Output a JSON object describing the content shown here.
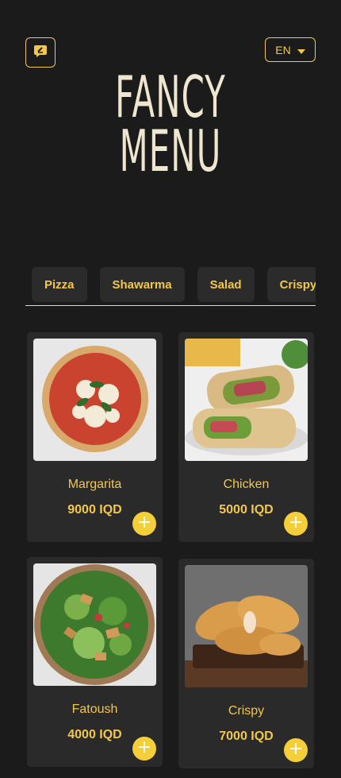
{
  "header": {
    "logo_line1": "FANCY",
    "logo_line2": "MENU",
    "language": "EN"
  },
  "categories": [
    "Pizza",
    "Shawarma",
    "Salad",
    "Crispy"
  ],
  "items": [
    {
      "name": "Margarita",
      "price": "9000 IQD"
    },
    {
      "name": "Chicken",
      "price": "5000 IQD"
    },
    {
      "name": "Fatoush",
      "price": "4000 IQD"
    },
    {
      "name": "Crispy",
      "price": "7000 IQD"
    }
  ],
  "colors": {
    "accent": "#f2c84b",
    "background": "#1b1b1b",
    "card": "#2a2a2a",
    "logo": "#efe6cf"
  }
}
